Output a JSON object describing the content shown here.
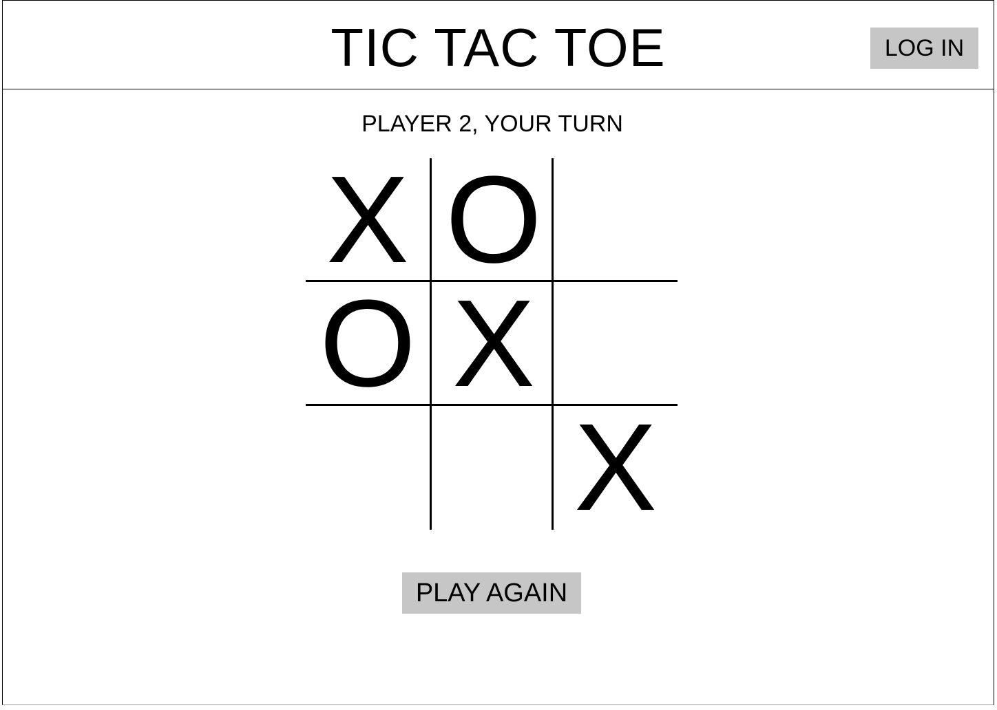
{
  "header": {
    "title": "TIC TAC TOE",
    "login_label": "LOG IN"
  },
  "game": {
    "status": "PLAYER 2, YOUR TURN",
    "board": [
      "X",
      "O",
      "",
      "O",
      "X",
      "",
      "",
      "",
      "X"
    ],
    "play_again_label": "PLAY AGAIN"
  }
}
